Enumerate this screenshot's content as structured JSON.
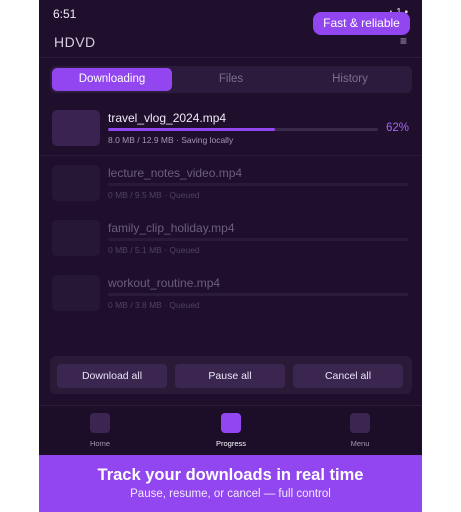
{
  "status": {
    "time": "6:51",
    "indicators": "▴ 1 ▪"
  },
  "badge": "Fast & reliable",
  "app": {
    "title": "HDVD",
    "menu_icon": "≡"
  },
  "tabs": [
    {
      "label": "Downloading",
      "active": true
    },
    {
      "label": "Files",
      "active": false
    },
    {
      "label": "History",
      "active": false
    }
  ],
  "downloads": [
    {
      "name": "travel_vlog_2024.mp4",
      "meta": "8.0 MB / 12.9 MB · Saving locally",
      "percent": "62%",
      "progress": 0.62
    },
    {
      "name": "lecture_notes_video.mp4",
      "meta": "0 MB / 9.5 MB · Queued",
      "progress": 0
    },
    {
      "name": "family_clip_holiday.mp4",
      "meta": "0 MB / 5.1 MB · Queued",
      "progress": 0
    },
    {
      "name": "workout_routine.mp4",
      "meta": "0 MB / 3.8 MB · Queued",
      "progress": 0
    }
  ],
  "actions": {
    "download_all": "Download all",
    "pause_all": "Pause all",
    "cancel_all": "Cancel all"
  },
  "nav": [
    {
      "label": "Home",
      "icon": "home-icon"
    },
    {
      "label": "Progress",
      "icon": "progress-icon",
      "active": true
    },
    {
      "label": "Menu",
      "icon": "menu-icon"
    }
  ],
  "promo": {
    "headline": "Track your downloads in real time",
    "sub": "Pause, resume, or cancel — full control"
  },
  "colors": {
    "accent": "#9146f0",
    "background": "#1f0f2d"
  }
}
